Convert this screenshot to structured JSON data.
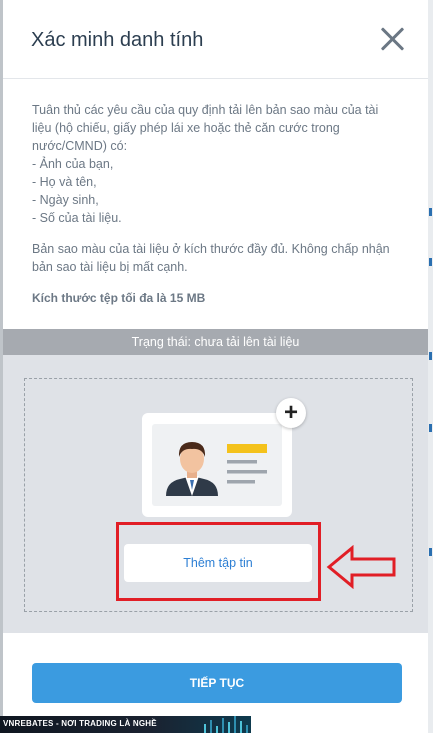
{
  "dialog": {
    "title": "Xác minh danh tính",
    "close_icon": "close-icon"
  },
  "instructions": {
    "intro": "Tuân thủ các yêu cầu của quy định tải lên bản sao màu của tài liệu (hộ chiếu, giấy phép lái xe hoặc thẻ căn cước trong nước/CMND) có:",
    "items": [
      "- Ảnh của bạn,",
      "- Họ và tên,",
      "- Ngày sinh,",
      "- Số của tài liệu."
    ],
    "note": "Bản sao màu của tài liệu ở kích thước đầy đủ. Không chấp nhận bản sao tài liệu bị mất cạnh.",
    "max_size": "Kích thước tệp tối đa là 15 MB"
  },
  "upload": {
    "status": "Trạng thái: chưa tải lên tài liệu",
    "add_file_label": "Thêm tập tin",
    "plus_icon": "plus-icon",
    "id_card_icon": "id-card-icon"
  },
  "footer": {
    "continue_label": "TIẾP TỤC"
  },
  "watermark": {
    "text": "VNREBATES - NƠI TRADING LÀ NGHỀ"
  },
  "colors": {
    "accent_blue": "#3b9be0",
    "link_blue": "#2d7fd4",
    "highlight_red": "#e11e26",
    "status_gray": "#a6aab0"
  }
}
